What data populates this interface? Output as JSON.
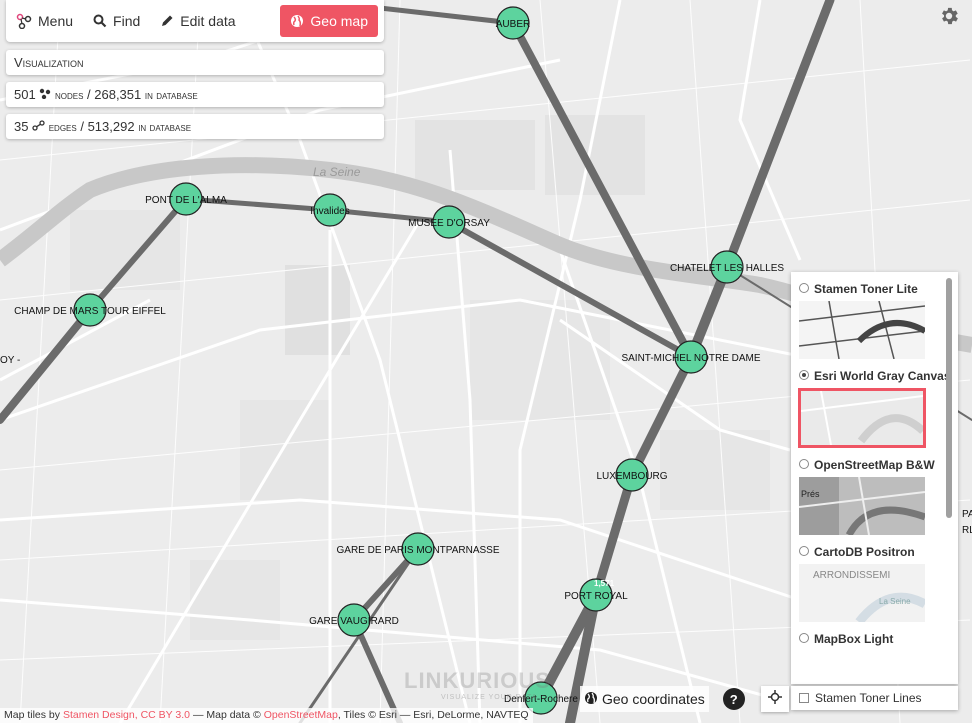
{
  "toolbar": {
    "menu_label": "Menu",
    "find_label": "Find",
    "edit_label": "Edit data",
    "geo_label": "Geo map"
  },
  "panels": {
    "visualization_title": "Visualization",
    "nodes_count": "501",
    "nodes_label": "nodes",
    "nodes_db_total": "268,351",
    "in_database": "in database",
    "edges_count": "35",
    "edges_label": "edges",
    "edges_db_total": "513,292"
  },
  "map": {
    "water_label": "La Seine",
    "partial_labels": [
      "OY -",
      "PA",
      "RLI"
    ],
    "edge_value_label": "1,571",
    "watermark_text": "LINKURIOUS",
    "watermark_sub": "VISUALIZE YOUR DATA",
    "nodes": [
      {
        "id": "auber",
        "label": "AUBER"
      },
      {
        "id": "alma",
        "label": "PONT DE L'ALMA"
      },
      {
        "id": "invalides",
        "label": "Invalides"
      },
      {
        "id": "orsay",
        "label": "MUSEE D'ORSAY"
      },
      {
        "id": "chatelet",
        "label": "CHATELET LES HALLES"
      },
      {
        "id": "champ",
        "label": "CHAMP DE MARS TOUR EIFFEL"
      },
      {
        "id": "stmichel",
        "label": "SAINT-MICHEL NOTRE DAME"
      },
      {
        "id": "luxembourg",
        "label": "LUXEMBOURG"
      },
      {
        "id": "montparnasse",
        "label": "GARE DE PARIS MONTPARNASSE"
      },
      {
        "id": "portroyal",
        "label": "PORT ROYAL"
      },
      {
        "id": "vaugirard",
        "label": "GARE VAUGIRARD"
      },
      {
        "id": "denfert",
        "label": "Denfert-Rochere"
      }
    ],
    "node_color": "#5dd39e",
    "edge_color": "#6b6b6b"
  },
  "layers": {
    "options": [
      {
        "label": "Stamen Toner Lite",
        "selected": false
      },
      {
        "label": "Esri World Gray Canvas",
        "selected": true
      },
      {
        "label": "OpenStreetMap B&W",
        "selected": false
      },
      {
        "label": "CartoDB Positron",
        "selected": false
      },
      {
        "label": "MapBox Light",
        "selected": false
      }
    ],
    "thumb_labels": {
      "osm": "Prés",
      "carto": "ARRONDISSEMI",
      "carto_river": "La Seine"
    },
    "footer_label": "Stamen Toner Lines"
  },
  "geo": {
    "coordinates_label": "Geo coordinates",
    "help_label": "?"
  },
  "attribution": {
    "prefix": "Map tiles by",
    "stamen": "Stamen Design",
    "sep1": ",",
    "license": "CC BY 3.0",
    "mid": "— Map data ©",
    "osm": "OpenStreetMap",
    "tail": ", Tiles © Esri — Esri, DeLorme, NAVTEQ"
  },
  "colors": {
    "accent": "#ef5564",
    "map_bg": "#eeeeee",
    "road": "#ffffff",
    "water": "#c9c9c9"
  }
}
